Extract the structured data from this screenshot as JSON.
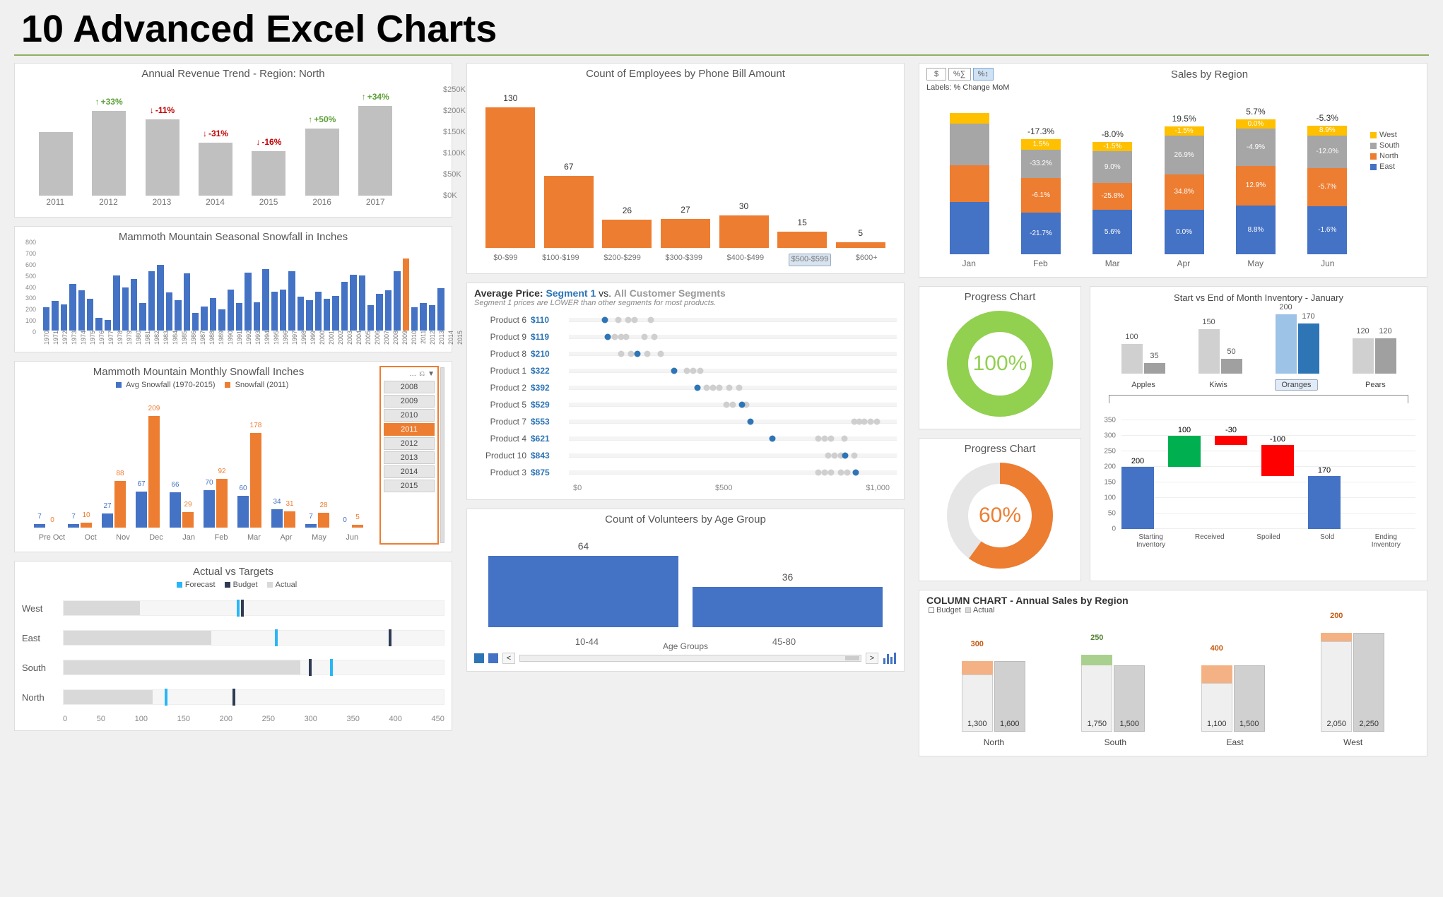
{
  "page_title": "10 Advanced Excel Charts",
  "colors": {
    "blue": "#4472c4",
    "orange": "#ed7d31",
    "gray": "#c0c0c0",
    "yellow": "#ffc000",
    "darkgray": "#7f7f7f",
    "green": "#70ad47",
    "red": "#c00000",
    "lightgray": "#d9d9d9"
  },
  "chart_data": [
    {
      "id": "revenue_trend",
      "title": "Annual Revenue Trend - Region: North",
      "type": "bar",
      "categories": [
        "2011",
        "2012",
        "2013",
        "2014",
        "2015",
        "2016",
        "2017"
      ],
      "values_k": [
        150,
        200,
        180,
        125,
        105,
        158,
        212
      ],
      "pct_change": [
        "",
        "+33%",
        "-11%",
        "-31%",
        "-16%",
        "+50%",
        "+34%"
      ],
      "pct_dir": [
        "",
        "up",
        "dn",
        "dn",
        "dn",
        "up",
        "up"
      ],
      "ylim": [
        0,
        250
      ],
      "yticks": [
        "$0K",
        "$50K",
        "$100K",
        "$150K",
        "$200K",
        "$250K"
      ]
    },
    {
      "id": "seasonal_snowfall",
      "title": "Mammoth Mountain Seasonal Snowfall in Inches",
      "type": "bar",
      "x_years": [
        "1970",
        "1971",
        "1972",
        "1973",
        "1974",
        "1975",
        "1976",
        "1977",
        "1978",
        "1979",
        "1980",
        "1981",
        "1982",
        "1983",
        "1984",
        "1985",
        "1986",
        "1987",
        "1988",
        "1989",
        "1990",
        "1991",
        "1992",
        "1993",
        "1994",
        "1995",
        "1996",
        "1997",
        "1998",
        "1999",
        "2000",
        "2001",
        "2002",
        "2003",
        "2004",
        "2005",
        "2006",
        "2007",
        "2008",
        "2009",
        "2010",
        "2011",
        "2012",
        "2013",
        "2014",
        "2015"
      ],
      "values": [
        220,
        280,
        250,
        440,
        380,
        300,
        120,
        100,
        520,
        410,
        490,
        260,
        560,
        620,
        360,
        290,
        540,
        170,
        230,
        310,
        200,
        390,
        260,
        550,
        270,
        580,
        370,
        390,
        560,
        320,
        290,
        370,
        300,
        330,
        460,
        530,
        520,
        240,
        350,
        380,
        560,
        680,
        220,
        260,
        240,
        400
      ],
      "highlight_year": "2011",
      "ylim": [
        0,
        800
      ],
      "yticks": [
        "0",
        "100",
        "200",
        "300",
        "400",
        "500",
        "600",
        "700",
        "800"
      ]
    },
    {
      "id": "monthly_snowfall",
      "title": "Mammoth Mountain Monthly Snowfall Inches",
      "type": "grouped_bar",
      "legend": {
        "avg": "Avg Snowfall (1970-2015)",
        "sel": "Snowfall (2011)"
      },
      "categories": [
        "Pre Oct",
        "Oct",
        "Nov",
        "Dec",
        "Jan",
        "Feb",
        "Mar",
        "Apr",
        "May",
        "Jun"
      ],
      "series": [
        {
          "name": "avg",
          "values": [
            7,
            7,
            27,
            67,
            66,
            70,
            60,
            34,
            7,
            0
          ]
        },
        {
          "name": "sel",
          "values": [
            0,
            10,
            88,
            209,
            29,
            92,
            178,
            31,
            28,
            5
          ]
        }
      ],
      "slicer_years": [
        "2008",
        "2009",
        "2010",
        "2011",
        "2012",
        "2013",
        "2014",
        "2015"
      ],
      "slicer_selected": "2011",
      "slicer_icons": [
        "…",
        "filter-clear",
        "funnel"
      ]
    },
    {
      "id": "actual_vs_targets",
      "title": "Actual vs Targets",
      "type": "bullet",
      "legend": [
        "Forecast",
        "Budget",
        "Actual"
      ],
      "max": 450,
      "xticks": [
        "0",
        "50",
        "100",
        "150",
        "200",
        "250",
        "300",
        "350",
        "400",
        "450"
      ],
      "rows": [
        {
          "name": "West",
          "actual": 90,
          "forecast": 205,
          "budget": 210
        },
        {
          "name": "East",
          "actual": 175,
          "forecast": 250,
          "budget": 385
        },
        {
          "name": "South",
          "actual": 280,
          "forecast": 315,
          "budget": 290
        },
        {
          "name": "North",
          "actual": 105,
          "forecast": 120,
          "budget": 200
        }
      ]
    },
    {
      "id": "phone_bill_histogram",
      "title": "Count of Employees by Phone Bill Amount",
      "type": "bar",
      "categories": [
        "$0-$99",
        "$100-$199",
        "$200-$299",
        "$300-$399",
        "$400-$499",
        "$500-$599",
        "$600+"
      ],
      "values": [
        130,
        67,
        26,
        27,
        30,
        15,
        5
      ],
      "selected_category": "$500-$599"
    },
    {
      "id": "avg_price_dot",
      "title_prefix": "Average Price: ",
      "title_seg": "Segment 1",
      "title_mid": " vs. ",
      "title_all": "All Customer Segments",
      "subtitle": "Segment 1 prices are LOWER than other segments for most products.",
      "type": "dot",
      "xmax": 1000,
      "xticks": [
        "$0",
        "$500",
        "$1,000"
      ],
      "rows": [
        {
          "name": "Product 6",
          "seg_price": 110,
          "seg_label": "$110",
          "others": [
            150,
            180,
            200,
            250
          ]
        },
        {
          "name": "Product 9",
          "seg_price": 119,
          "seg_label": "$119",
          "others": [
            140,
            160,
            175,
            230,
            260
          ]
        },
        {
          "name": "Product 8",
          "seg_price": 210,
          "seg_label": "$210",
          "others": [
            160,
            190,
            240,
            280
          ]
        },
        {
          "name": "Product 1",
          "seg_price": 322,
          "seg_label": "$322",
          "others": [
            360,
            380,
            400
          ]
        },
        {
          "name": "Product 2",
          "seg_price": 392,
          "seg_label": "$392",
          "others": [
            420,
            440,
            460,
            490,
            520
          ]
        },
        {
          "name": "Product 5",
          "seg_price": 529,
          "seg_label": "$529",
          "others": [
            480,
            500,
            540
          ]
        },
        {
          "name": "Product 7",
          "seg_price": 553,
          "seg_label": "$553",
          "others": [
            870,
            885,
            900,
            920,
            940
          ]
        },
        {
          "name": "Product 4",
          "seg_price": 621,
          "seg_label": "$621",
          "others": [
            760,
            780,
            800,
            840
          ]
        },
        {
          "name": "Product 10",
          "seg_price": 843,
          "seg_label": "$843",
          "others": [
            790,
            810,
            830,
            870
          ]
        },
        {
          "name": "Product 3",
          "seg_price": 875,
          "seg_label": "$875",
          "others": [
            760,
            780,
            800,
            830,
            850
          ]
        }
      ]
    },
    {
      "id": "volunteers_hist",
      "title": "Count of Volunteers by Age Group",
      "type": "bar",
      "xlabel": "Age Groups",
      "categories": [
        "10-44",
        "45-80"
      ],
      "values": [
        64,
        36
      ],
      "widths_pct": [
        50,
        50
      ]
    },
    {
      "id": "sales_by_region",
      "title": "Sales by Region",
      "buttons": [
        "$",
        "%∑",
        "%↕"
      ],
      "selected_button_index": 2,
      "labels_text": "Labels: % Change MoM",
      "type": "stacked_bar",
      "categories": [
        "Jan",
        "Feb",
        "Mar",
        "Apr",
        "May",
        "Jun"
      ],
      "legend": [
        "West",
        "South",
        "North",
        "East"
      ],
      "legend_colors": [
        "#ffc000",
        "#a6a6a6",
        "#ed7d31",
        "#4472c4"
      ],
      "top_pct": [
        "",
        "-17.3%",
        "-8.0%",
        "19.5%",
        "5.7%",
        "-5.3%"
      ],
      "heights": [
        {
          "East": 75,
          "North": 52,
          "South": 60,
          "West": 15
        },
        {
          "East": 60,
          "North": 49,
          "South": 41,
          "West": 15
        },
        {
          "East": 64,
          "North": 38,
          "South": 45,
          "West": 14
        },
        {
          "East": 64,
          "North": 50,
          "South": 56,
          "West": 13
        },
        {
          "East": 70,
          "North": 56,
          "South": 54,
          "West": 13
        },
        {
          "East": 69,
          "North": 54,
          "South": 47,
          "West": 14
        }
      ],
      "seg_labels": [
        {
          "East": "",
          "North": "",
          "South": "",
          "West": ""
        },
        {
          "East": "-21.7%",
          "North": "-6.1%",
          "South": "-33.2%",
          "West": "1.5%"
        },
        {
          "East": "5.6%",
          "North": "-25.8%",
          "South": "9.0%",
          "West": "-1.5%"
        },
        {
          "East": "0.0%",
          "North": "34.8%",
          "South": "26.9%",
          "West": "-1.5%"
        },
        {
          "East": "8.8%",
          "North": "12.9%",
          "South": "-4.9%",
          "West": "0.0%"
        },
        {
          "East": "-1.6%",
          "North": "-5.7%",
          "South": "-12.0%",
          "West": "8.9%"
        }
      ]
    },
    {
      "id": "progress_100",
      "title": "Progress Chart",
      "type": "donut",
      "value_pct": 100,
      "color": "#92d050",
      "label": "100%"
    },
    {
      "id": "progress_60",
      "title": "Progress Chart",
      "type": "donut",
      "value_pct": 60,
      "color": "#ed7d31",
      "label": "60%"
    },
    {
      "id": "inventory_grouped",
      "title": "Start vs End of Month Inventory - January",
      "type": "grouped_bar",
      "categories": [
        "Apples",
        "Kiwis",
        "Oranges",
        "Pears"
      ],
      "selected": "Oranges",
      "series": [
        {
          "name": "start",
          "values": [
            100,
            150,
            200,
            120
          ],
          "color": "#d0d0d0"
        },
        {
          "name": "end",
          "values": [
            35,
            50,
            170,
            120
          ],
          "color": "#a0a0a0"
        }
      ],
      "selected_colors": {
        "start": "#9dc3e6",
        "end": "#2e75b6"
      }
    },
    {
      "id": "inventory_waterfall",
      "type": "waterfall",
      "ylim": [
        0,
        350
      ],
      "yticks": [
        "0",
        "50",
        "100",
        "150",
        "200",
        "250",
        "300",
        "350"
      ],
      "categories": [
        "Starting Inventory",
        "Received",
        "Spoiled",
        "Sold",
        "Ending Inventory"
      ],
      "labels": [
        "200",
        "100",
        "-30",
        "-100",
        "170"
      ],
      "bars": [
        {
          "bottom": 0,
          "top": 200,
          "color": "#4472c4"
        },
        {
          "bottom": 200,
          "top": 300,
          "color": "#00b050"
        },
        {
          "bottom": 270,
          "top": 300,
          "color": "#ff0000"
        },
        {
          "bottom": 170,
          "top": 270,
          "color": "#ff0000"
        },
        {
          "bottom": 0,
          "top": 170,
          "color": "#4472c4"
        }
      ]
    },
    {
      "id": "annual_sales_region",
      "title": "COLUMN CHART - Annual Sales by Region",
      "type": "grouped_bar_with_delta",
      "legend": [
        "Budget",
        "Actual"
      ],
      "categories": [
        "North",
        "South",
        "East",
        "West"
      ],
      "max": 2500,
      "rows": [
        {
          "name": "North",
          "budget": 1300,
          "actual": 1600,
          "delta": 300,
          "delta_dir": "up"
        },
        {
          "name": "South",
          "budget": 1750,
          "actual": 1500,
          "delta": 250,
          "delta_dir": "down"
        },
        {
          "name": "East",
          "budget": 1100,
          "actual": 1500,
          "delta": 400,
          "delta_dir": "up"
        },
        {
          "name": "West",
          "budget": 2050,
          "actual": 2250,
          "delta": 200,
          "delta_dir": "up"
        }
      ],
      "labels": [
        {
          "budget": "1,300",
          "actual": "1,600",
          "delta": "300"
        },
        {
          "budget": "1,750",
          "actual": "1,500",
          "delta": "250"
        },
        {
          "budget": "1,100",
          "actual": "1,500",
          "delta": "400"
        },
        {
          "budget": "2,050",
          "actual": "2,250",
          "delta": "200"
        }
      ]
    }
  ]
}
